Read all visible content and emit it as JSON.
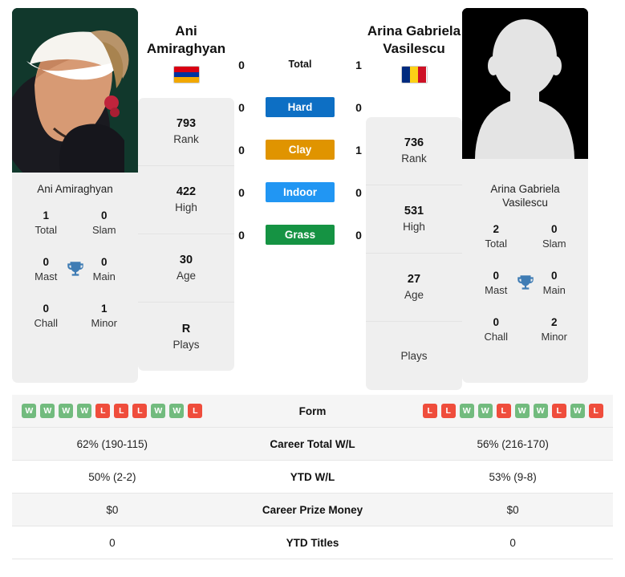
{
  "left_player": {
    "first_name": "Ani",
    "last_name": "Amiraghyan",
    "full_name": "Ani Amiraghyan",
    "flag_name": "armenia-flag",
    "flag_colors": [
      "#d90012",
      "#0033a0",
      "#f2a800"
    ],
    "flag_orientation": "horizontal",
    "photo_name": "player-photo",
    "rank": {
      "value": "793",
      "label": "Rank"
    },
    "high": {
      "value": "422",
      "label": "High"
    },
    "age": {
      "value": "30",
      "label": "Age"
    },
    "plays": {
      "value": "R",
      "label": "Plays"
    },
    "titles": [
      {
        "value": "1",
        "label": "Total"
      },
      {
        "value": "0",
        "label": "Slam"
      },
      {
        "value": "0",
        "label": "Mast"
      },
      {
        "value": "0",
        "label": "Main"
      },
      {
        "value": "0",
        "label": "Chall"
      },
      {
        "value": "1",
        "label": "Minor"
      }
    ],
    "form": [
      "W",
      "W",
      "W",
      "W",
      "L",
      "L",
      "L",
      "W",
      "W",
      "L"
    ],
    "career_wl": "62% (190-115)",
    "ytd_wl": "50% (2-2)",
    "prize_money": "$0",
    "ytd_titles": "0"
  },
  "right_player": {
    "first_name": "Arina Gabriela",
    "last_name": "Vasilescu",
    "full_name": "Arina Gabriela Vasilescu",
    "flag_name": "romania-flag",
    "flag_colors": [
      "#002b7f",
      "#fcd116",
      "#ce1126"
    ],
    "flag_orientation": "vertical",
    "photo_name": "player-photo-placeholder",
    "rank": {
      "value": "736",
      "label": "Rank"
    },
    "high": {
      "value": "531",
      "label": "High"
    },
    "age": {
      "value": "27",
      "label": "Age"
    },
    "plays": {
      "value": "",
      "label": "Plays"
    },
    "titles": [
      {
        "value": "2",
        "label": "Total"
      },
      {
        "value": "0",
        "label": "Slam"
      },
      {
        "value": "0",
        "label": "Mast"
      },
      {
        "value": "0",
        "label": "Main"
      },
      {
        "value": "0",
        "label": "Chall"
      },
      {
        "value": "2",
        "label": "Minor"
      }
    ],
    "form": [
      "L",
      "L",
      "W",
      "W",
      "L",
      "W",
      "W",
      "L",
      "W",
      "L"
    ],
    "career_wl": "56% (216-170)",
    "ytd_wl": "53% (9-8)",
    "prize_money": "$0",
    "ytd_titles": "0"
  },
  "head_to_head": [
    {
      "label": "Total",
      "left": "0",
      "right": "1",
      "color": "",
      "text_color": "#111111"
    },
    {
      "label": "Hard",
      "left": "0",
      "right": "0",
      "color": "#0d6fc4",
      "text_color": "#ffffff"
    },
    {
      "label": "Clay",
      "left": "0",
      "right": "1",
      "color": "#e09400",
      "text_color": "#ffffff"
    },
    {
      "label": "Indoor",
      "left": "0",
      "right": "0",
      "color": "#2196f3",
      "text_color": "#ffffff"
    },
    {
      "label": "Grass",
      "left": "0",
      "right": "0",
      "color": "#159343",
      "text_color": "#ffffff"
    }
  ],
  "comparison_rows": [
    {
      "label": "Form",
      "left": "",
      "right": "",
      "type": "form"
    },
    {
      "label": "Career Total W/L",
      "left": "62% (190-115)",
      "right": "56% (216-170)",
      "type": "text"
    },
    {
      "label": "YTD W/L",
      "left": "50% (2-2)",
      "right": "53% (9-8)",
      "type": "text"
    },
    {
      "label": "Career Prize Money",
      "left": "$0",
      "right": "$0",
      "type": "text"
    },
    {
      "label": "YTD Titles",
      "left": "0",
      "right": "0",
      "type": "text"
    }
  ],
  "colors": {
    "win": "#72bb7e",
    "loss": "#ef4d3c",
    "card_bg": "#efefef",
    "trophy": "#3f7cb4"
  }
}
